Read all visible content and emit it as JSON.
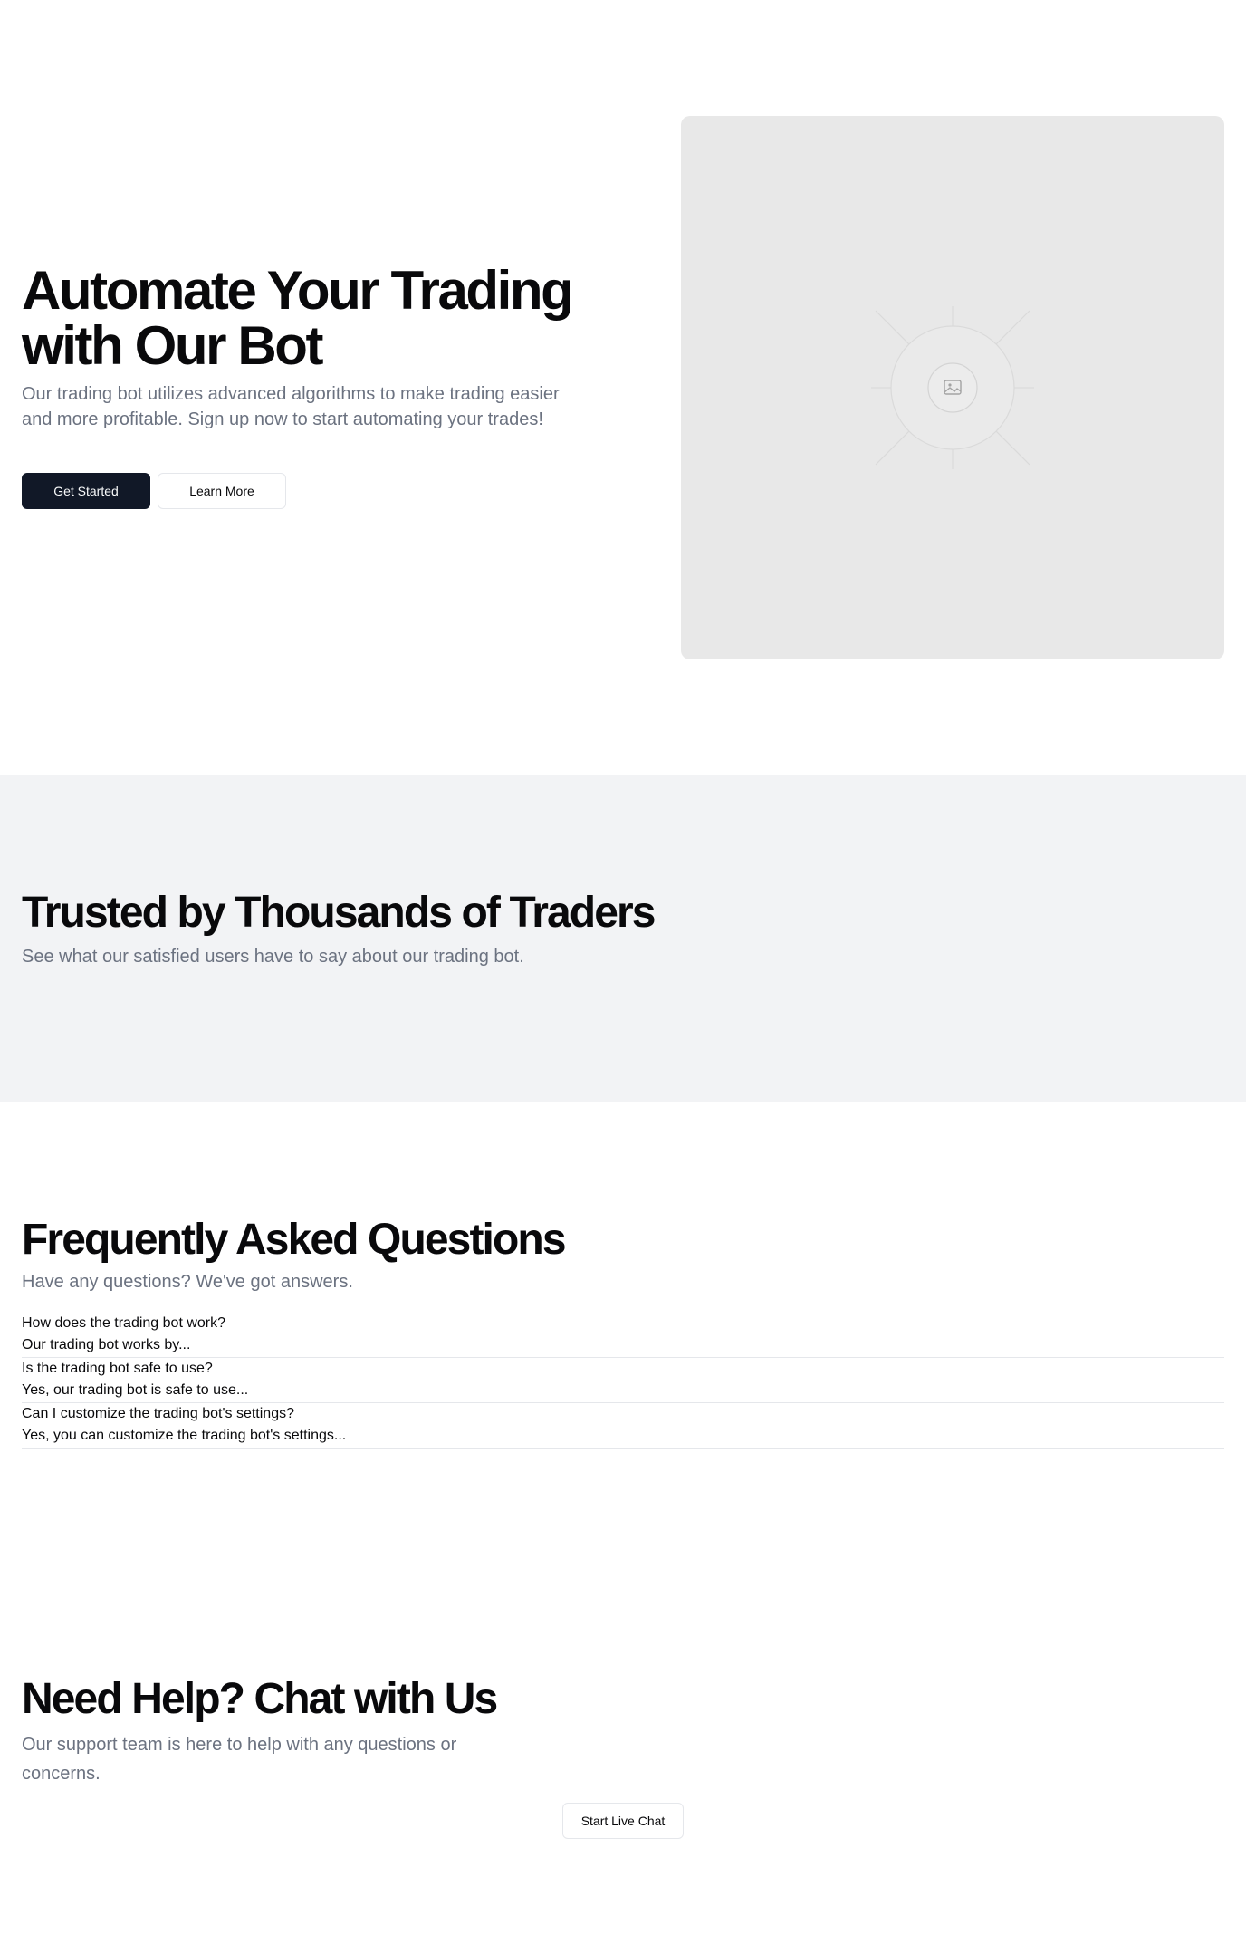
{
  "hero": {
    "title": "Automate Your Trading with Our Bot",
    "subtitle": "Our trading bot utilizes advanced algorithms to make trading easier and more profitable. Sign up now to start automating your trades!",
    "primary_button": "Get Started",
    "secondary_button": "Learn More",
    "image_icon": "image-placeholder-icon"
  },
  "testimonials": {
    "title": "Trusted by Thousands of Traders",
    "subtitle": "See what our satisfied users have to say about our trading bot."
  },
  "faq": {
    "title": "Frequently Asked Questions",
    "subtitle": "Have any questions? We've got answers.",
    "items": [
      {
        "question": "How does the trading bot work?",
        "answer": "Our trading bot works by..."
      },
      {
        "question": "Is the trading bot safe to use?",
        "answer": "Yes, our trading bot is safe to use..."
      },
      {
        "question": "Can I customize the trading bot's settings?",
        "answer": "Yes, you can customize the trading bot's settings..."
      }
    ]
  },
  "support": {
    "title": "Need Help? Chat with Us",
    "subtitle": "Our support team is here to help with any questions or concerns.",
    "button": "Start Live Chat"
  },
  "colors": {
    "primary_button_bg": "#111827",
    "muted_text": "#6b7280",
    "section_bg": "#f2f3f5",
    "placeholder_bg": "#e8e8e8"
  }
}
